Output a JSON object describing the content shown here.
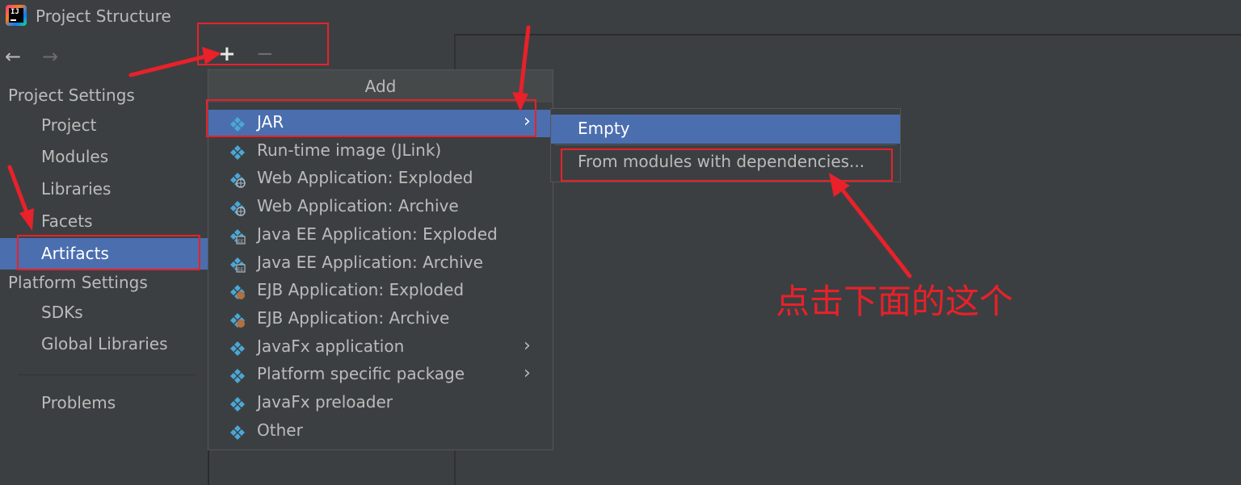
{
  "window": {
    "title": "Project Structure"
  },
  "sidebar": {
    "back_icon": "←",
    "forward_icon": "→",
    "project_settings_header": "Project Settings",
    "project_items": [
      "Project",
      "Modules",
      "Libraries",
      "Facets",
      "Artifacts"
    ],
    "selected_item": "Artifacts",
    "platform_settings_header": "Platform Settings",
    "platform_items": [
      "SDKs",
      "Global Libraries"
    ],
    "problems": "Problems"
  },
  "toolbar": {
    "add_icon": "+",
    "remove_icon": "−",
    "copy_icon": "copy-icon"
  },
  "add_popup": {
    "title": "Add",
    "items": [
      {
        "label": "JAR",
        "icon": "jar-icon",
        "submenu": true,
        "selected": true
      },
      {
        "label": "Run-time image (JLink)",
        "icon": "jlink-icon",
        "submenu": false
      },
      {
        "label": "Web Application: Exploded",
        "icon": "web-app-icon",
        "submenu": false
      },
      {
        "label": "Web Application: Archive",
        "icon": "web-app-icon",
        "submenu": false
      },
      {
        "label": "Java EE Application: Exploded",
        "icon": "javaee-icon",
        "submenu": false
      },
      {
        "label": "Java EE Application: Archive",
        "icon": "javaee-icon",
        "submenu": false
      },
      {
        "label": "EJB Application: Exploded",
        "icon": "ejb-icon",
        "submenu": false
      },
      {
        "label": "EJB Application: Archive",
        "icon": "ejb-icon",
        "submenu": false
      },
      {
        "label": "JavaFx application",
        "icon": "javafx-icon",
        "submenu": true
      },
      {
        "label": "Platform specific package",
        "icon": "package-icon",
        "submenu": true
      },
      {
        "label": "JavaFx preloader",
        "icon": "javafx-icon",
        "submenu": false
      },
      {
        "label": "Other",
        "icon": "other-icon",
        "submenu": false
      }
    ],
    "submenu_arrow": "›"
  },
  "jar_submenu": {
    "items": [
      "Empty",
      "From modules with dependencies..."
    ],
    "selected": "Empty"
  },
  "annotation": {
    "text": "点击下面的这个",
    "color": "#e8212a"
  },
  "colors": {
    "background": "#3c3f41",
    "selection": "#4b6eaf",
    "text": "#bbbbbb",
    "icon_blue": "#4aa8d8"
  }
}
